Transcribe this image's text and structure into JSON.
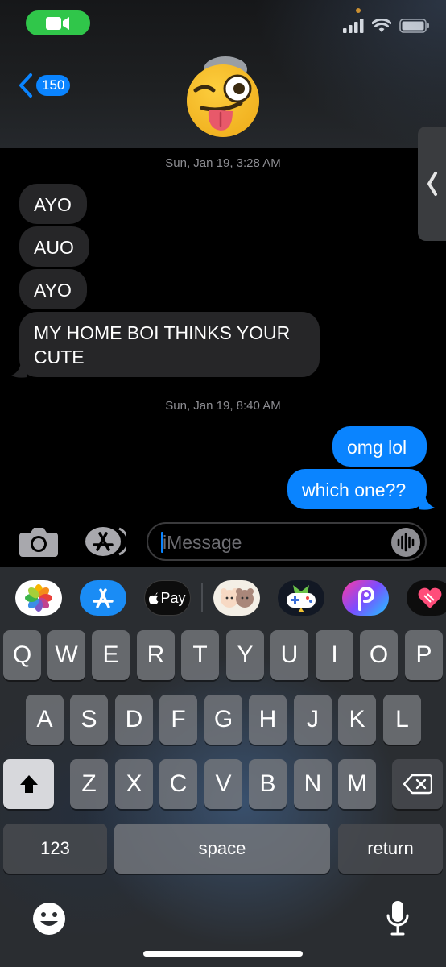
{
  "status": {
    "signal": "cellular-signal-icon",
    "wifi": "wifi-icon",
    "battery": "battery-icon"
  },
  "header": {
    "back_count": "150",
    "avatar": "winking-face-with-tongue-icon"
  },
  "conversation": {
    "timestamps": [
      "Sun, Jan 19, 3:28 AM",
      "Sun, Jan 19, 8:40 AM"
    ],
    "incoming": [
      "AYO",
      "AUO",
      "AYO",
      "MY HOME BOI THINKS YOUR CUTE"
    ],
    "outgoing": [
      "omg lol",
      "which one??"
    ]
  },
  "compose": {
    "placeholder": "iMessage"
  },
  "apps": {
    "apple_pay": "Pay"
  },
  "keyboard": {
    "row1": [
      "Q",
      "W",
      "E",
      "R",
      "T",
      "Y",
      "U",
      "I",
      "O",
      "P"
    ],
    "row2": [
      "A",
      "S",
      "D",
      "F",
      "G",
      "H",
      "J",
      "K",
      "L"
    ],
    "row3": [
      "Z",
      "X",
      "C",
      "V",
      "B",
      "N",
      "M"
    ],
    "numbers": "123",
    "space": "space",
    "return": "return"
  },
  "colors": {
    "imessage_blue": "#0a84ff",
    "incoming_bubble": "#262628",
    "facetime_green": "#30c64a"
  }
}
